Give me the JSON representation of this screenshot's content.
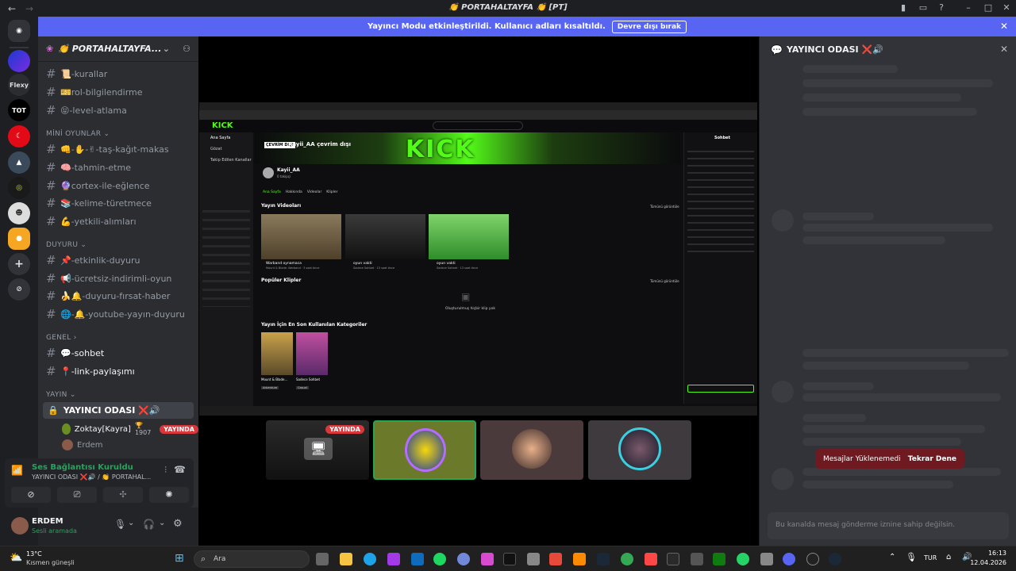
{
  "window": {
    "title": "👏 PORTAHALTAYFA 👏 [PT]"
  },
  "banner": {
    "text": "Yayıncı Modu etkinleştirildi. Kullanıcı adları kısaltıldı.",
    "button": "Devre dışı bırak"
  },
  "server": {
    "name": "👏 PORTAHALTAYFA..."
  },
  "channels": [
    {
      "label": "📜-kurallar"
    },
    {
      "label": "🎫rol-bilgilendirme"
    },
    {
      "label": "😝-level-atlama"
    }
  ],
  "categories": {
    "mini": "MİNİ OYUNLAR",
    "duyuru": "DUYURU",
    "genel": "GENEL",
    "yayin": "YAYIN"
  },
  "mini_channels": [
    {
      "label": "👊-✋-✌-taş-kağıt-makas"
    },
    {
      "label": "🧠-tahmin-etme"
    },
    {
      "label": "🔮cortex-ile-eğlence"
    },
    {
      "label": "📚-kelime-türetmece"
    },
    {
      "label": "💪-yetkili-alımları"
    }
  ],
  "duyuru_channels": [
    {
      "label": "📌-etkinlik-duyuru"
    },
    {
      "label": "📢-ücretsiz-indirimli-oyun"
    },
    {
      "label": "🍌🔔-duyuru-fırsat-haber"
    },
    {
      "label": "🌐-🔔-youtube-yayın-duyuru"
    }
  ],
  "genel_channels": [
    {
      "label": "💬-sohbet"
    },
    {
      "label": "📍-link-paylaşımı"
    }
  ],
  "voice_room": {
    "label": "YAYINCI ODASI ❌🔊",
    "users": [
      {
        "name": "Zoktay[Kayra]",
        "badge": "🏆 1907",
        "live": "YAYINDA"
      },
      {
        "name": "Erdem"
      }
    ]
  },
  "voice_panel": {
    "status": "Ses Bağlantısı Kuruldu",
    "sub": "YAYINCI ODASI ❌🔊 / 👏 PORTAHAL..."
  },
  "user": {
    "name": "ERDEM",
    "status": "Sesli aramada"
  },
  "stream": {
    "channel": "Kayii_AA çevrim dışı",
    "offline": "ÇEVRİM DIŞI",
    "streamer": "Kayii_AA",
    "followers": "0 takipçi",
    "section_videos": "Yayın Videoları",
    "see_all": "Tümünü görüntüle",
    "section_clips": "Popüler Klipler",
    "no_clips": "Oluşturulmuş hiçbir klip yok",
    "section_cats": "Yayın İçin En Son Kullanılan Kategoriler",
    "chat_title": "Sohbet",
    "sidebar_items": [
      "Ana Sayfa",
      "Gözat",
      "Takip Edilen Kanallar"
    ],
    "tabs": [
      "Ana Sayfa",
      "Hakkında",
      "Videolar",
      "Klipler"
    ],
    "videos": [
      {
        "title": "Warband oynamaca",
        "meta": "Mount & Blade: Warband · 3 saat önce"
      },
      {
        "title": "oyun vakti",
        "meta": "Sadece Sohbet · 15 saat önce"
      },
      {
        "title": "oyun vakti",
        "meta": "Sadece Sohbet · 13 saat önce"
      }
    ],
    "categories": [
      {
        "name": "Mount & Blade...",
        "tag": "Adventure"
      },
      {
        "name": "Sadece Sohbet",
        "tag": "Casual"
      }
    ]
  },
  "thumbs": [
    {
      "live": "YAYINDA"
    }
  ],
  "right": {
    "title": "YAYINCI ODASI ❌🔊",
    "error": "Mesajlar Yüklenemedi",
    "retry": "Tekrar Dene",
    "input_placeholder": "Bu kanalda mesaj gönderme iznine sahip değilsin."
  },
  "taskbar": {
    "weather_temp": "13°C",
    "weather_text": "Kısmen güneşli",
    "search": "Ara",
    "lang": "TUR",
    "time": "16:13",
    "date": "12.04.2026"
  }
}
